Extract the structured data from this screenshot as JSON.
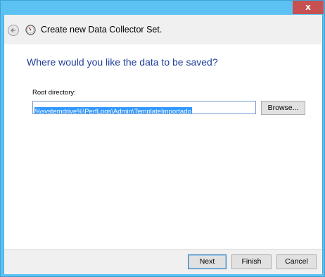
{
  "window": {
    "close_label": "x"
  },
  "header": {
    "title": "Create new Data Collector Set.",
    "back_icon": "back-arrow-icon",
    "wizard_icon": "data-collector-wizard-icon"
  },
  "main": {
    "question": "Where would you like the data to be saved?",
    "root_directory_label": "Root directory:",
    "root_directory_value": "%systemdrive%\\PerfLogs\\Admin\\TemplateImportado",
    "browse_label": "Browse..."
  },
  "footer": {
    "next_label": "Next",
    "finish_label": "Finish",
    "cancel_label": "Cancel"
  },
  "colors": {
    "titlebar": "#5bc2f3",
    "close": "#c75050",
    "heading": "#1e3e9a",
    "selection": "#3399ff"
  }
}
